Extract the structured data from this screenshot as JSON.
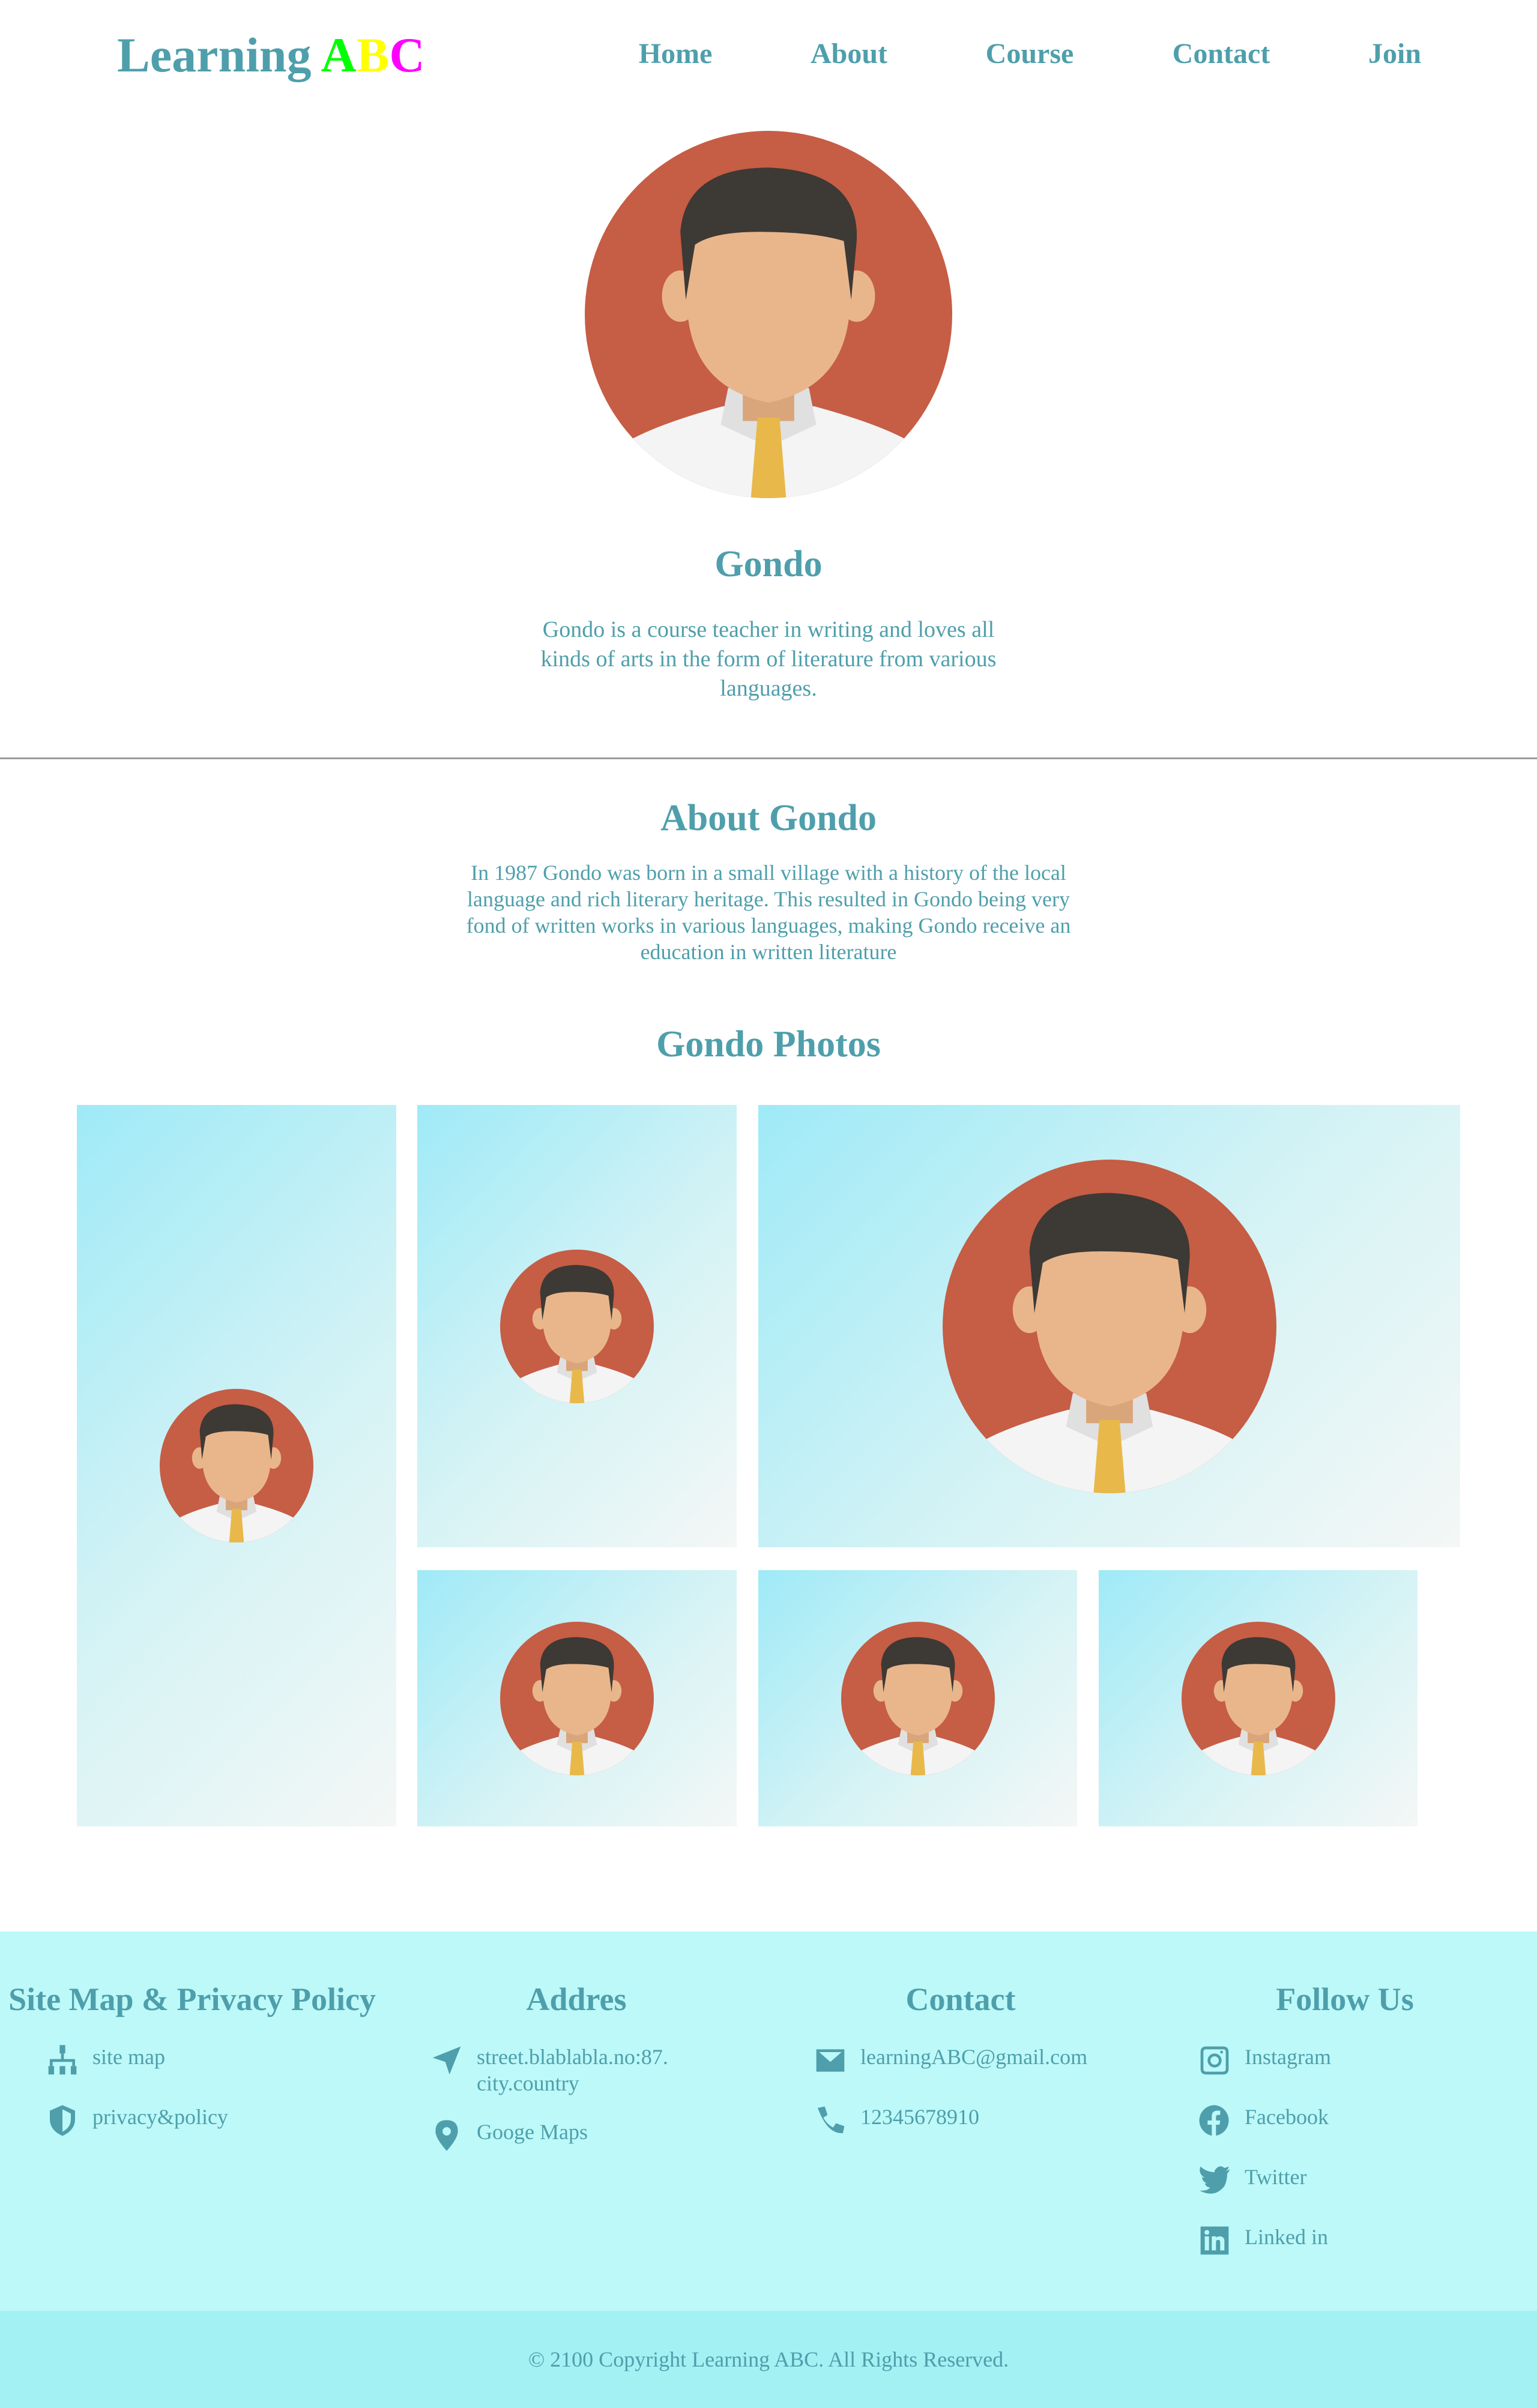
{
  "header": {
    "logo_text": "Learning ",
    "logo_letters": [
      "A",
      "B",
      "C"
    ],
    "logo_letter_colors": [
      "#00ff00",
      "#ffff00",
      "#ff00ff"
    ],
    "nav": [
      "Home",
      "About",
      "Course",
      "Contact",
      "Join"
    ]
  },
  "profile": {
    "name": "Gondo",
    "description": "Gondo is a course teacher in writing and loves all kinds of arts in the form of literature from various languages."
  },
  "about": {
    "title": "About Gondo",
    "text": "In 1987 Gondo was born in a small village with a history of the local language and rich literary heritage. This resulted in Gondo being very fond of written works in various languages, making Gondo receive an education in written literature"
  },
  "photos": {
    "title": "Gondo Photos"
  },
  "footer": {
    "sitemap": {
      "title": "Site Map & Privacy Policy",
      "items": [
        "site map",
        "privacy&policy"
      ]
    },
    "address": {
      "title": "Addres",
      "items": [
        "street.blablabla.no:87. city.country",
        "Googe Maps"
      ]
    },
    "contact": {
      "title": "Contact",
      "items": [
        "learningABC@gmail.com",
        "12345678910"
      ]
    },
    "follow": {
      "title": "Follow Us",
      "items": [
        "Instagram",
        "Facebook",
        "Twitter",
        "Linked in"
      ]
    },
    "copyright": "© 2100 Copyright Learning ABC. All Rights Reserved."
  },
  "colors": {
    "text": "#4e9fab",
    "footer_bg": "#bdf9f9",
    "copyright_bg": "#a3f1f3",
    "avatar_bg": "#c65d45"
  }
}
